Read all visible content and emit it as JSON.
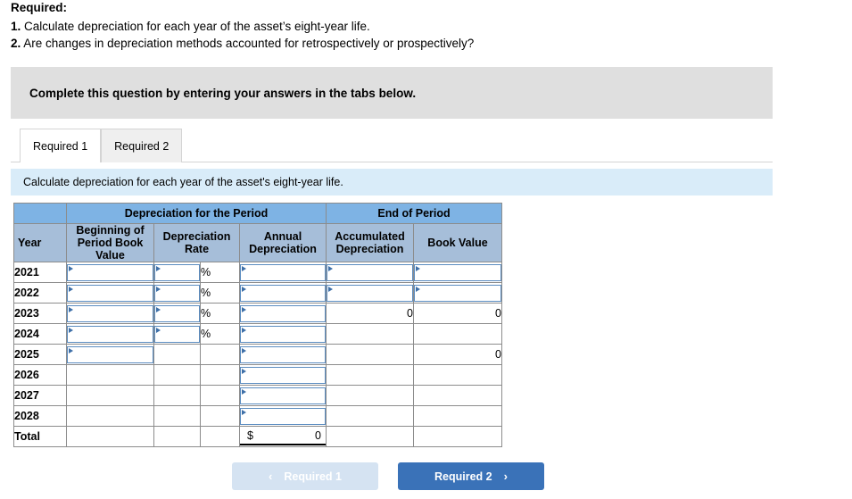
{
  "required": {
    "title": "Required:",
    "items": [
      {
        "num": "1.",
        "text": "Calculate depreciation for each year of the asset’s eight-year life."
      },
      {
        "num": "2.",
        "text": "Are changes in depreciation methods accounted for retrospectively or prospectively?"
      }
    ]
  },
  "instruction_panel": {
    "text": "Complete this question by entering your answers in the tabs below."
  },
  "tabs": [
    {
      "label": "Required 1",
      "active": true
    },
    {
      "label": "Required 2",
      "active": false
    }
  ],
  "blue_bar": {
    "text": "Calculate depreciation for each year of the asset's eight-year life."
  },
  "table": {
    "group_headers": {
      "blank": "",
      "period": "Depreciation for the Period",
      "end": "End of Period"
    },
    "column_headers": {
      "year": "Year",
      "beginning": "Beginning of Period Book Value",
      "rate": "Depreciation Rate",
      "rate_unit": "",
      "annual": "Annual Depreciation",
      "accumulated": "Accumulated Depreciation",
      "book_value": "Book Value"
    },
    "percent_symbol": "%",
    "currency_symbol": "$",
    "rows": [
      {
        "year": "2021",
        "beginning": {
          "type": "input",
          "value": ""
        },
        "rate": {
          "type": "input",
          "value": ""
        },
        "rate_unit": "%",
        "annual": {
          "type": "input",
          "value": ""
        },
        "accumulated": {
          "type": "input",
          "value": ""
        },
        "book_value": {
          "type": "input",
          "value": ""
        }
      },
      {
        "year": "2022",
        "beginning": {
          "type": "input",
          "value": ""
        },
        "rate": {
          "type": "input",
          "value": ""
        },
        "rate_unit": "%",
        "annual": {
          "type": "input",
          "value": ""
        },
        "accumulated": {
          "type": "input",
          "value": ""
        },
        "book_value": {
          "type": "input",
          "value": ""
        }
      },
      {
        "year": "2023",
        "beginning": {
          "type": "input",
          "value": ""
        },
        "rate": {
          "type": "input",
          "value": ""
        },
        "rate_unit": "%",
        "annual": {
          "type": "input",
          "value": ""
        },
        "accumulated": {
          "type": "text",
          "value": "0"
        },
        "book_value": {
          "type": "text",
          "value": "0"
        }
      },
      {
        "year": "2024",
        "beginning": {
          "type": "input",
          "value": ""
        },
        "rate": {
          "type": "input",
          "value": ""
        },
        "rate_unit": "%",
        "annual": {
          "type": "input",
          "value": ""
        },
        "accumulated": {
          "type": "text",
          "value": ""
        },
        "book_value": {
          "type": "text",
          "value": ""
        }
      },
      {
        "year": "2025",
        "beginning": {
          "type": "input",
          "value": ""
        },
        "rate": {
          "type": "text",
          "value": ""
        },
        "rate_unit": "",
        "annual": {
          "type": "input",
          "value": ""
        },
        "accumulated": {
          "type": "text",
          "value": ""
        },
        "book_value": {
          "type": "text",
          "value": "0"
        }
      },
      {
        "year": "2026",
        "beginning": {
          "type": "text",
          "value": ""
        },
        "rate": {
          "type": "text",
          "value": ""
        },
        "rate_unit": "",
        "annual": {
          "type": "input",
          "value": ""
        },
        "accumulated": {
          "type": "text",
          "value": ""
        },
        "book_value": {
          "type": "text",
          "value": ""
        }
      },
      {
        "year": "2027",
        "beginning": {
          "type": "text",
          "value": ""
        },
        "rate": {
          "type": "text",
          "value": ""
        },
        "rate_unit": "",
        "annual": {
          "type": "input",
          "value": ""
        },
        "accumulated": {
          "type": "text",
          "value": ""
        },
        "book_value": {
          "type": "text",
          "value": ""
        }
      },
      {
        "year": "2028",
        "beginning": {
          "type": "text",
          "value": ""
        },
        "rate": {
          "type": "text",
          "value": ""
        },
        "rate_unit": "",
        "annual": {
          "type": "input",
          "value": ""
        },
        "accumulated": {
          "type": "text",
          "value": ""
        },
        "book_value": {
          "type": "text",
          "value": ""
        }
      }
    ],
    "total_row": {
      "year": "Total",
      "beginning": "",
      "rate": "",
      "rate_unit": "",
      "annual_currency": "$",
      "annual_value": "0",
      "accumulated": "",
      "book_value": ""
    }
  },
  "nav": {
    "prev": {
      "label": "Required 1",
      "chevron": "‹",
      "enabled": false
    },
    "next": {
      "label": "Required 2",
      "chevron": "›",
      "enabled": true
    }
  },
  "colors": {
    "header_top": "#7eb3e4",
    "header_sub": "#a6bed9",
    "instruction_gray": "#dfdfdf",
    "blue_bar": "#d9ecf9",
    "button_primary": "#3a72b8",
    "button_disabled": "#d5e3f2",
    "input_border": "#5b8cc0"
  }
}
